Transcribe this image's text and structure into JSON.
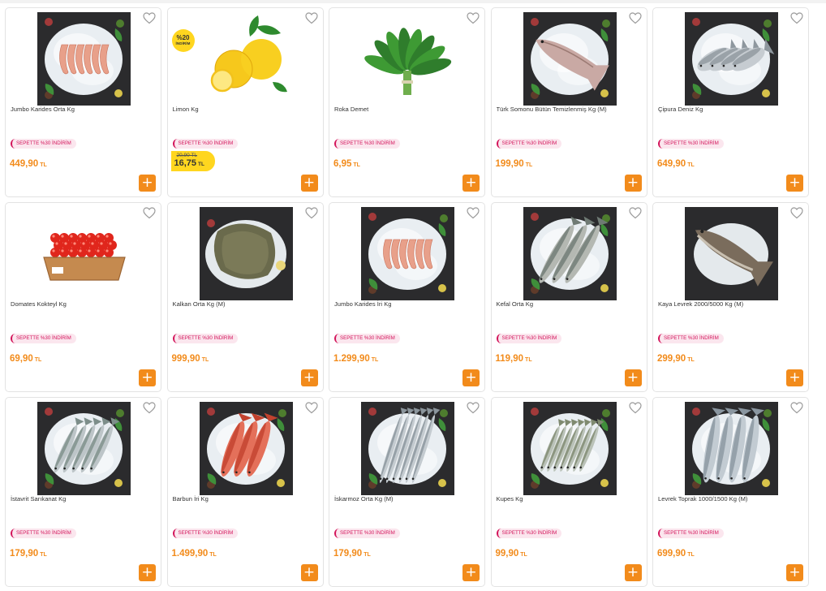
{
  "currency": "TL",
  "promo_text": "SEPETTE %30 İNDİRİM",
  "add_symbol": "+",
  "products": [
    {
      "name": "Jumbo Karides Orta Kg",
      "price": "449,90",
      "image": "shrimp"
    },
    {
      "name": "Limon Kg",
      "price": "16,75",
      "old_price": "20,90 TL",
      "badge_pct": "%20",
      "badge_label": "İNDİRİM",
      "image": "lemon"
    },
    {
      "name": "Roka Demet",
      "price": "6,95",
      "image": "arugula"
    },
    {
      "name": "Türk Somonu Bütün Temizlenmiş Kg (M)",
      "price": "199,90",
      "image": "salmon"
    },
    {
      "name": "Çipura Deniz Kg",
      "price": "649,90",
      "image": "bream"
    },
    {
      "name": "Domates Kokteyl Kg",
      "price": "69,90",
      "image": "tomato"
    },
    {
      "name": "Kalkan Orta Kg (M)",
      "price": "999,90",
      "image": "turbot"
    },
    {
      "name": "Jumbo Karides İri Kg",
      "price": "1.299,90",
      "image": "shrimp"
    },
    {
      "name": "Kefal Orta Kg",
      "price": "119,90",
      "image": "mullet"
    },
    {
      "name": "Kaya Levrek 2000/5000 Kg (M)",
      "price": "299,90",
      "image": "bass_single"
    },
    {
      "name": "İstavrit Sarıkanat Kg",
      "price": "179,90",
      "image": "mackerel"
    },
    {
      "name": "Barbun İri Kg",
      "price": "1.499,90",
      "image": "redmullet"
    },
    {
      "name": "İskarmoz Orta Kg (M)",
      "price": "179,90",
      "image": "garfish"
    },
    {
      "name": "Kupes Kg",
      "price": "99,90",
      "image": "bogue"
    },
    {
      "name": "Levrek Toprak 1000/1500 Kg (M)",
      "price": "699,90",
      "image": "seabass"
    }
  ]
}
